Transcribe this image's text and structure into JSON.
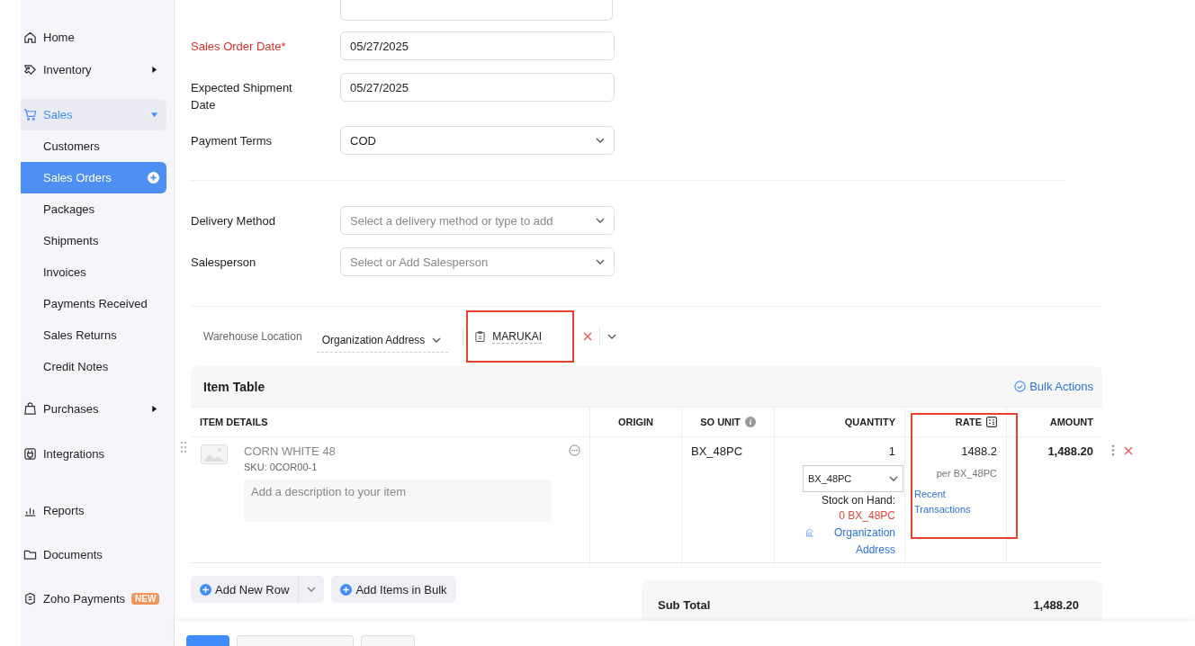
{
  "sidebar": {
    "items": [
      {
        "label": "Home"
      },
      {
        "label": "Inventory",
        "expanded": false
      },
      {
        "label": "Sales",
        "expanded": true,
        "children": [
          {
            "label": "Customers",
            "selected": false
          },
          {
            "label": "Sales Orders",
            "selected": true,
            "add": true
          },
          {
            "label": "Packages",
            "selected": false
          },
          {
            "label": "Shipments",
            "selected": false
          },
          {
            "label": "Invoices",
            "selected": false
          },
          {
            "label": "Payments Received",
            "selected": false
          },
          {
            "label": "Sales Returns",
            "selected": false
          },
          {
            "label": "Credit Notes",
            "selected": false
          }
        ]
      },
      {
        "label": "Purchases",
        "expanded": false
      },
      {
        "label": "Integrations"
      },
      {
        "label": "Reports"
      },
      {
        "label": "Documents"
      },
      {
        "label": "Zoho Payments",
        "badge": "NEW"
      }
    ]
  },
  "form": {
    "sections": [
      [
        {
          "label": "Sales Order Date*",
          "required": true,
          "kind": "text",
          "value": "05/27/2025"
        },
        {
          "label": "Expected Shipment Date",
          "required": false,
          "kind": "text",
          "value": "05/27/2025"
        },
        {
          "label": "Payment Terms",
          "required": false,
          "kind": "select",
          "value": "COD"
        }
      ],
      [
        {
          "label": "Delivery Method",
          "required": false,
          "kind": "select",
          "placeholder": "Select a delivery method or type to add"
        },
        {
          "label": "Salesperson",
          "required": false,
          "kind": "select",
          "placeholder": "Select or Add Salesperson"
        }
      ]
    ]
  },
  "warehouse": {
    "label": "Warehouse Location",
    "value": "Organization Address",
    "customer": "MARUKAI",
    "highlighted": true
  },
  "item_table": {
    "title": "Item Table",
    "bulk_action": "Bulk Actions",
    "columns": [
      {
        "label": "ITEM DETAILS",
        "highlighted": false
      },
      {
        "label": "ORIGIN",
        "highlighted": false
      },
      {
        "label": "SO UNIT",
        "info": true,
        "highlighted": false
      },
      {
        "label": "QUANTITY",
        "highlighted": false
      },
      {
        "label": "RATE",
        "calc": true,
        "highlighted": true
      },
      {
        "label": "AMOUNT",
        "highlighted": false
      }
    ],
    "rows": [
      {
        "name": "CORN WHITE 48",
        "sku": "SKU: 0COR00-1",
        "description_placeholder": "Add a description to your item",
        "so_unit": "BX_48PC",
        "quantity": "1",
        "unit_select": "BX_48PC",
        "stock_label": "Stock on Hand:",
        "stock_value": "0 BX_48PC",
        "stock_location": "Organization Address",
        "rate": "1488.2",
        "rate_unit": "per BX_48PC",
        "rate_link": "Recent Transactions",
        "amount": "1,488.20"
      }
    ]
  },
  "row_buttons": [
    "Add New Row",
    "Add Items in Bulk"
  ],
  "sub_total": {
    "label": "Sub Total",
    "value": "1,488.20"
  }
}
